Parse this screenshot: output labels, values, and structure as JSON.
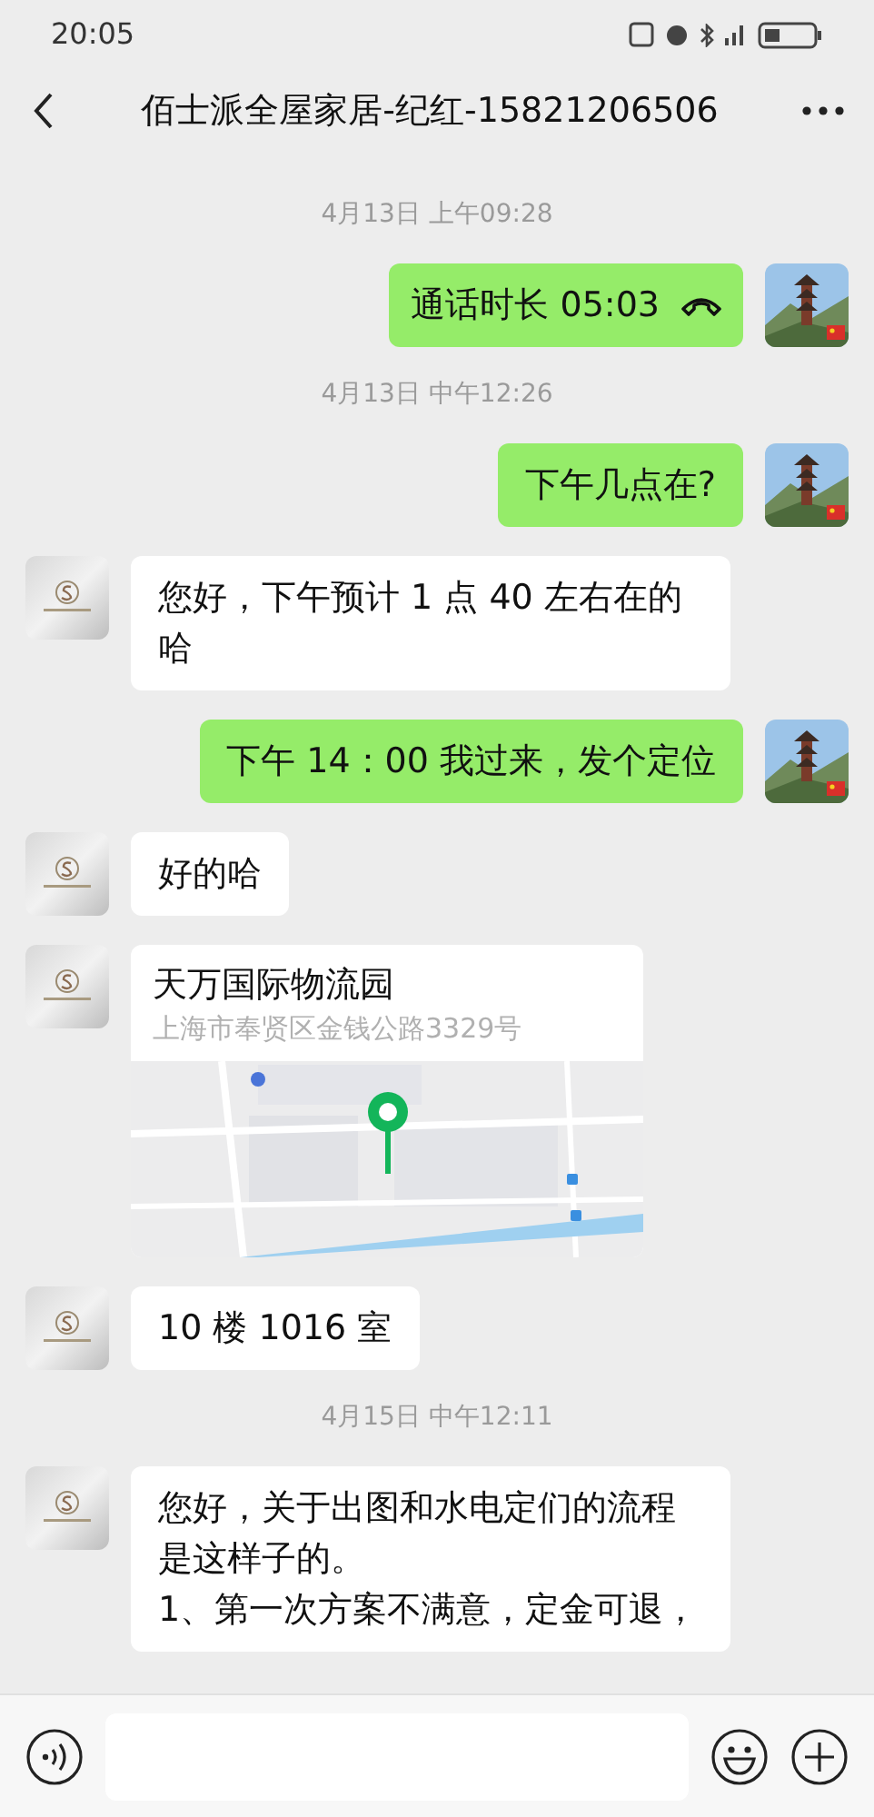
{
  "status_bar": {
    "time": "20:05"
  },
  "header": {
    "title": "佰士派全屋家居-纪红-15821206506"
  },
  "messages": [
    {
      "kind": "time",
      "text": "4月13日 上午09:28"
    },
    {
      "kind": "call",
      "outgoing": true,
      "text": "通话时长 05:03"
    },
    {
      "kind": "time",
      "text": "4月13日 中午12:26"
    },
    {
      "kind": "text",
      "outgoing": true,
      "text": "下午几点在?"
    },
    {
      "kind": "text",
      "outgoing": false,
      "text": "您好，下午预计 1 点 40 左右在的哈"
    },
    {
      "kind": "text",
      "outgoing": true,
      "text": "下午 14：00 我过来，发个定位"
    },
    {
      "kind": "text",
      "outgoing": false,
      "text": "好的哈"
    },
    {
      "kind": "location",
      "outgoing": false,
      "title": "天万国际物流园",
      "address": "上海市奉贤区金钱公路3329号"
    },
    {
      "kind": "text",
      "outgoing": false,
      "text": "10 楼 1016 室"
    },
    {
      "kind": "time",
      "text": "4月15日 中午12:11"
    },
    {
      "kind": "text",
      "outgoing": false,
      "text": "您好，关于出图和水电定们的流程是这样子的。\n1、第一次方案不满意，定金可退，"
    }
  ]
}
